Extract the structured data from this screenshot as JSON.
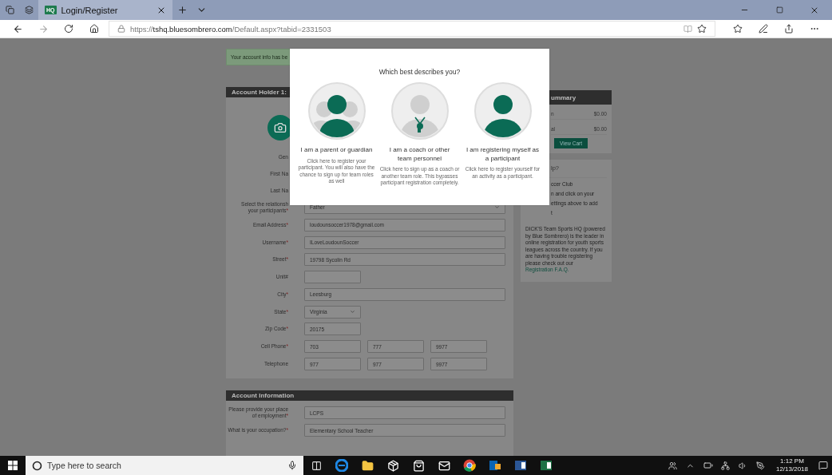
{
  "browser": {
    "tabs": [
      {
        "favicon": "HQ",
        "title": "Login/Register",
        "selected": true
      }
    ],
    "url": "https://**tshq.bluesombrero.com**/Default.aspx?tabid=2331503"
  },
  "page": {
    "notice": "Your account info has be",
    "holder_header": "Account Holder 1:",
    "rows": [
      {
        "kind": "covered",
        "label": "Gen"
      },
      {
        "kind": "covered",
        "label": "First Na"
      },
      {
        "kind": "covered",
        "label": "Last Na"
      },
      {
        "kind": "select",
        "label": "Select the relationsh",
        "label_2": "your participants",
        "mark": "*",
        "value": "Father"
      },
      {
        "kind": "text",
        "label": "Email Address",
        "mark": "*",
        "value": "loudounsoccer1978@gmail.com"
      },
      {
        "kind": "text",
        "label": "Username",
        "mark": "*",
        "value": "ILoveLoudounSoccer"
      },
      {
        "kind": "text",
        "label": "Street",
        "mark": "*",
        "value": "19798 Sycolin Rd"
      },
      {
        "kind": "short",
        "label": "Unit#"
      },
      {
        "kind": "text",
        "label": "City",
        "mark": "*",
        "value": "Leesburg"
      },
      {
        "kind": "short_select",
        "label": "State",
        "mark": "*",
        "value": "Virginia"
      },
      {
        "kind": "short",
        "label": "Zip Code",
        "mark": "*",
        "value": "20175"
      },
      {
        "kind": "phone",
        "label": "Cell Phone",
        "mark": "*",
        "parts": [
          "703",
          "777",
          "9977"
        ]
      },
      {
        "kind": "phone",
        "label": "Telephone",
        "parts": [
          "977",
          "977",
          "9977"
        ]
      }
    ],
    "account_header": "Account Information",
    "account_rows": [
      {
        "kind": "text",
        "label": "Please provide your place",
        "label_2": "of employment",
        "mark": "*",
        "value": "LCPS"
      },
      {
        "kind": "text",
        "label": "What is your occupation?",
        "mark": "*",
        "value": "Elementary School Teacher"
      }
    ]
  },
  "sidebar": {
    "summary_header": "ummary",
    "summary_rows": [
      {
        "label": "n",
        "amount": "$0.00"
      },
      {
        "label": "al",
        "amount": "$0.00"
      }
    ],
    "cart_button": "View Cart",
    "help_header": "lp?",
    "help_lines": [
      "ccer Club",
      "n and click on your",
      "ettings above to add",
      "t"
    ],
    "about": "DICK'S Team Sports HQ (powered by Blue Sombrero) is the leader in online registration for youth sports leagues across the country. If you are having trouble registering please check out our",
    "faq_link": "Registration F.A.Q."
  },
  "modal": {
    "title": "Which best describes you?",
    "options": [
      {
        "kind": "parent",
        "title": "I am a parent or guardian",
        "description": "Click here to register your participant. You will also have the chance to sign up for team roles as well"
      },
      {
        "kind": "coach",
        "title": "I am a coach or other team personnel",
        "description": "Click here to sign up as a coach or another team role. This bypasses participant registration completely."
      },
      {
        "kind": "self",
        "title": "I am registering myself as a participant",
        "description": "Click here to register yourself for an activity as a participant."
      }
    ]
  },
  "taskbar": {
    "search_placeholder": "Type here to search",
    "time": "1:12 PM",
    "date": "12/13/2018"
  }
}
